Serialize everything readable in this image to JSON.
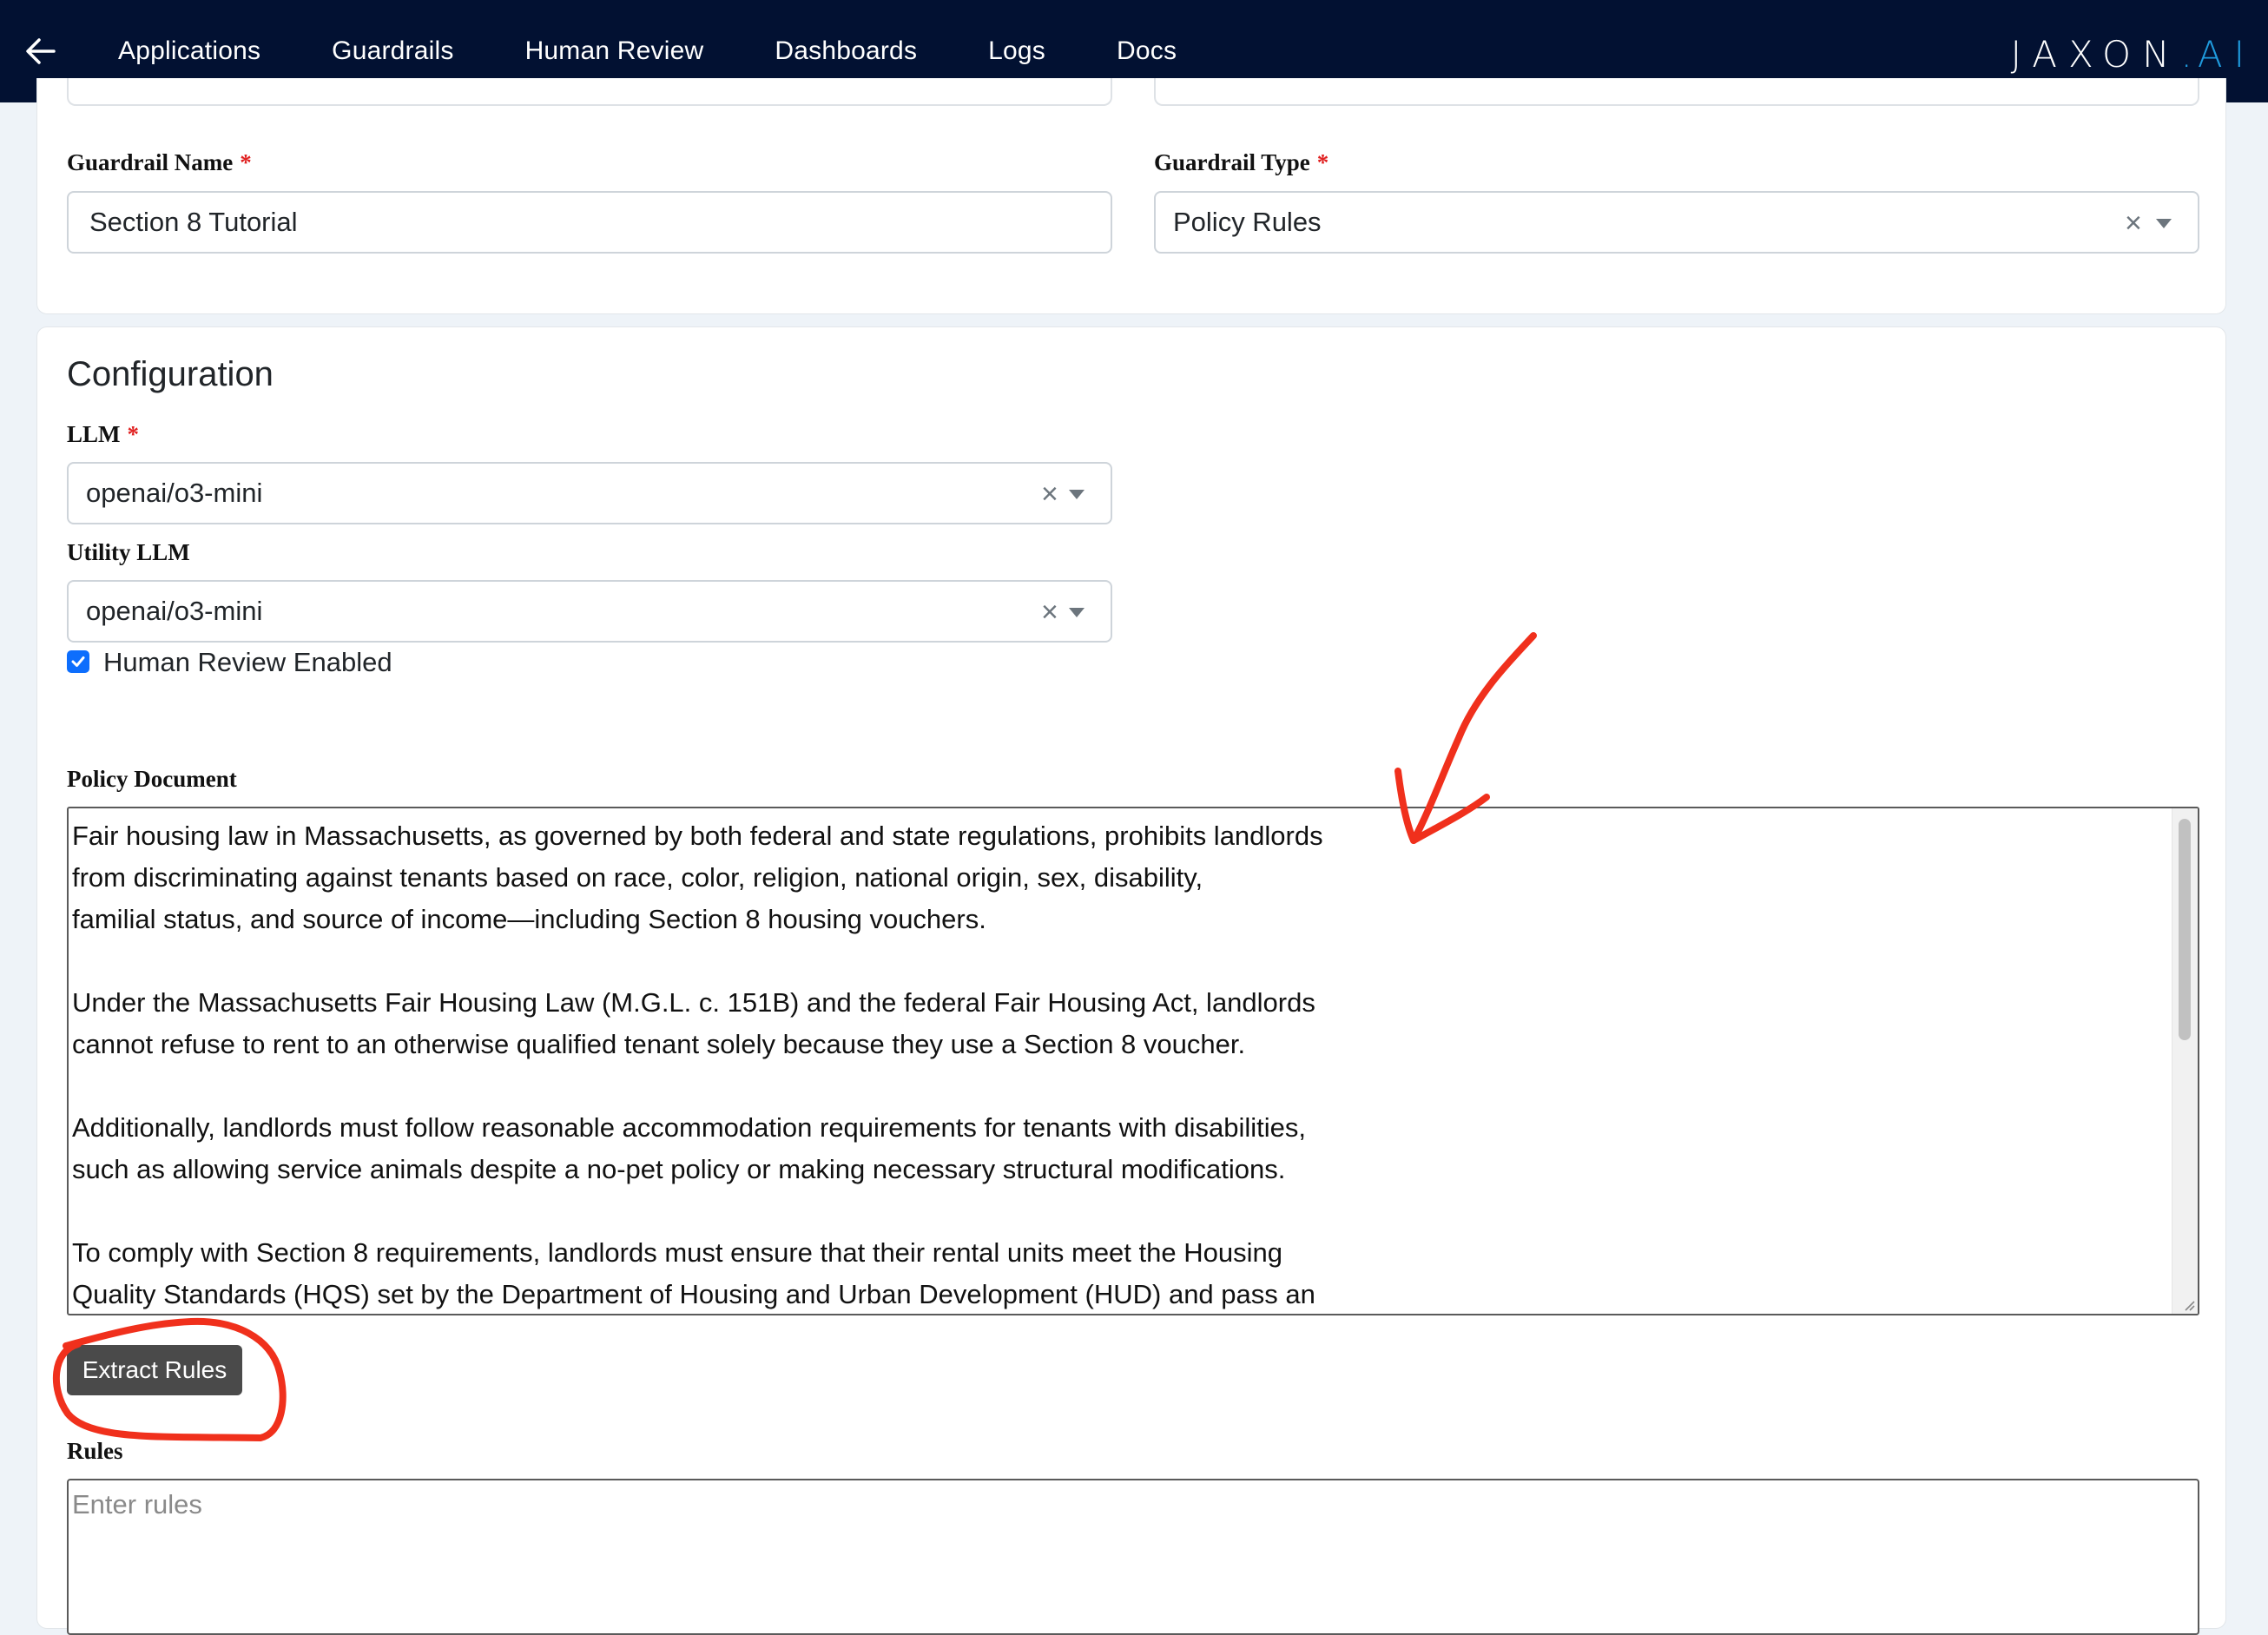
{
  "topbar": {
    "back_icon": "back-arrow-icon",
    "nav_items": [
      "Applications",
      "Guardrails",
      "Human Review",
      "Dashboards",
      "Logs",
      "Docs"
    ],
    "brand_main": "JAXON",
    "brand_dot": ".",
    "brand_suffix": "AI",
    "bg_color": "#021132",
    "brand_accent": "#1f9bde"
  },
  "guardrail": {
    "name_label": "Guardrail Name",
    "name_required": "*",
    "name_value": "Section 8 Tutorial",
    "type_label": "Guardrail Type",
    "type_required": "*",
    "type_value": "Policy Rules"
  },
  "configuration": {
    "title": "Configuration",
    "llm_label": "LLM",
    "llm_required": "*",
    "llm_value": "openai/o3-mini",
    "utility_llm_label": "Utility LLM",
    "utility_llm_value": "openai/o3-mini",
    "human_review_label": "Human Review Enabled",
    "human_review_checked": true,
    "policy_document_label": "Policy Document",
    "policy_document_text": "Fair housing law in Massachusetts, as governed by both federal and state regulations, prohibits landlords\nfrom discriminating against tenants based on race, color, religion, national origin, sex, disability,\nfamilial status, and source of income—including Section 8 housing vouchers.\n\nUnder the Massachusetts Fair Housing Law (M.G.L. c. 151B) and the federal Fair Housing Act, landlords\ncannot refuse to rent to an otherwise qualified tenant solely because they use a Section 8 voucher.\n\nAdditionally, landlords must follow reasonable accommodation requirements for tenants with disabilities,\nsuch as allowing service animals despite a no-pet policy or making necessary structural modifications.\n\nTo comply with Section 8 requirements, landlords must ensure that their rental units meet the Housing\nQuality Standards (HQS) set by the Department of Housing and Urban Development (HUD) and pass an",
    "extract_button_label": "Extract Rules",
    "rules_label": "Rules",
    "rules_placeholder": "Enter rules"
  },
  "annotations": {
    "color": "#f0301c",
    "arrow_icon": "red-arrow-annotation",
    "circle_icon": "red-circle-annotation"
  }
}
